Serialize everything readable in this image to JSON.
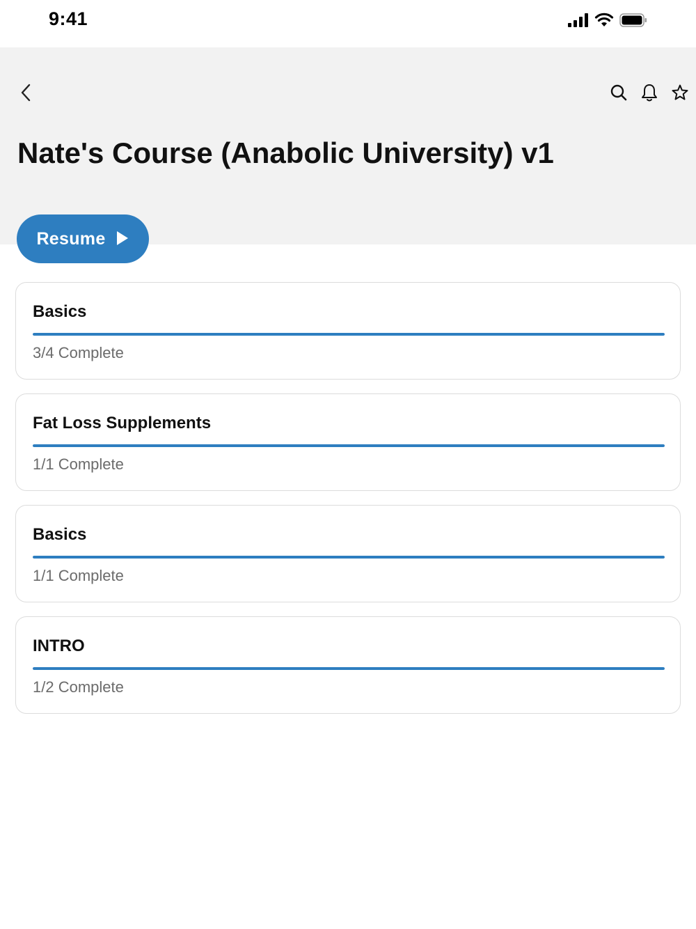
{
  "status_bar": {
    "time": "9:41",
    "icons": [
      "cellular-signal-icon",
      "wifi-icon",
      "battery-icon"
    ]
  },
  "nav": {
    "back_icon": "chevron-left-icon",
    "actions": [
      "search-icon",
      "bell-icon",
      "star-icon"
    ]
  },
  "course": {
    "title": "Nate's Course (Anabolic University) v1"
  },
  "resume": {
    "label": "Resume",
    "icon": "play-icon"
  },
  "colors": {
    "accent": "#2e7ec0",
    "header_bg": "#f2f2f2",
    "card_border": "#dcdcdc",
    "muted_text": "#6b6b6b"
  },
  "sections": [
    {
      "title": "Basics",
      "status": "3/4 Complete",
      "progress": 1.0
    },
    {
      "title": "Fat Loss Supplements",
      "status": "1/1 Complete",
      "progress": 1.0
    },
    {
      "title": "Basics",
      "status": "1/1 Complete",
      "progress": 1.0
    },
    {
      "title": "INTRO",
      "status": "1/2 Complete",
      "progress": 1.0
    }
  ]
}
